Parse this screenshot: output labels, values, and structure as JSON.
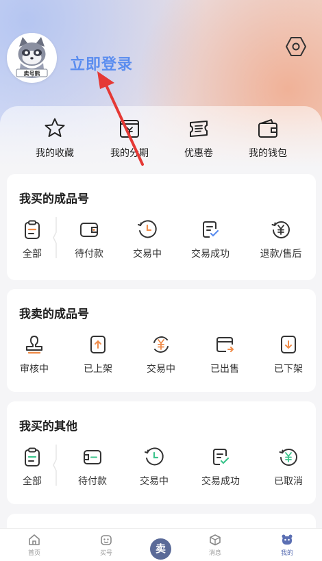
{
  "header": {
    "login_label": "立即登录",
    "avatar_badge": "卖号熊",
    "settings_icon": "settings-hexagon-icon"
  },
  "quick_links": [
    {
      "label": "我的收藏",
      "icon": "star-icon"
    },
    {
      "label": "我的分期",
      "icon": "installment-icon"
    },
    {
      "label": "优惠卷",
      "icon": "coupon-icon"
    },
    {
      "label": "我的钱包",
      "icon": "wallet-icon"
    }
  ],
  "buy_products": {
    "title": "我买的成品号",
    "items": [
      {
        "label": "全部",
        "icon": "clipboard-icon"
      },
      {
        "label": "待付款",
        "icon": "wallet-pending-icon"
      },
      {
        "label": "交易中",
        "icon": "clock-icon"
      },
      {
        "label": "交易成功",
        "icon": "document-check-icon"
      },
      {
        "label": "退款/售后",
        "icon": "refund-icon"
      }
    ]
  },
  "sell_products": {
    "title": "我卖的成品号",
    "items": [
      {
        "label": "审核中",
        "icon": "stamp-icon"
      },
      {
        "label": "已上架",
        "icon": "shelf-up-icon"
      },
      {
        "label": "交易中",
        "icon": "exchange-yuan-icon"
      },
      {
        "label": "已出售",
        "icon": "sold-card-icon"
      },
      {
        "label": "已下架",
        "icon": "shelf-down-icon"
      }
    ]
  },
  "buy_other": {
    "title": "我买的其他",
    "items": [
      {
        "label": "全部",
        "icon": "clipboard-icon"
      },
      {
        "label": "待付款",
        "icon": "wallet-pending-icon"
      },
      {
        "label": "交易中",
        "icon": "clock-icon"
      },
      {
        "label": "交易成功",
        "icon": "document-check-icon"
      },
      {
        "label": "已取消",
        "icon": "cancel-yuan-icon"
      }
    ]
  },
  "tabbar": {
    "items": [
      {
        "label": "首页",
        "icon": "home-icon"
      },
      {
        "label": "买号",
        "icon": "buy-icon"
      },
      {
        "label": "",
        "icon": "sell-button"
      },
      {
        "label": "消息",
        "icon": "message-box-icon"
      },
      {
        "label": "我的",
        "icon": "profile-bear-icon"
      }
    ],
    "sell_label": "卖",
    "active_color": "#5b6fb3",
    "inactive_color": "#999999"
  },
  "colors": {
    "accent": "#5b8def",
    "orange": "#f08c4a",
    "green": "#3cc48c",
    "arrow_red": "#e53935"
  }
}
